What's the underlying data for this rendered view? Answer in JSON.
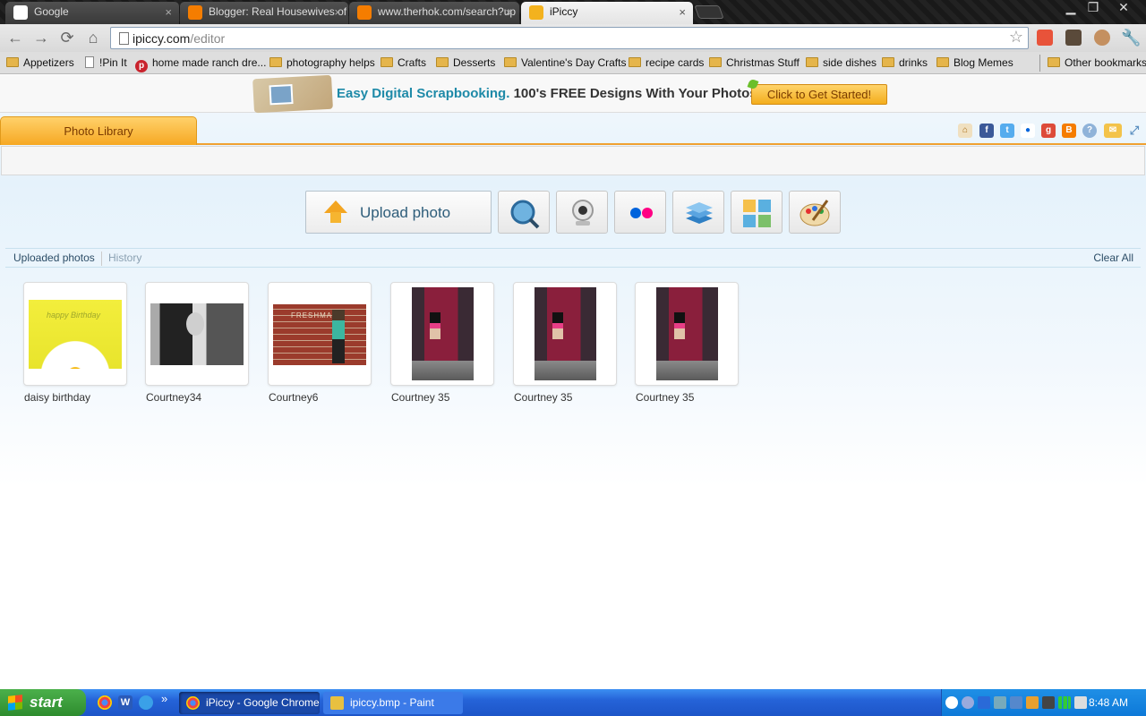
{
  "browser": {
    "tabs": [
      {
        "title": "Google",
        "active": false
      },
      {
        "title": "Blogger: Real Housewives of",
        "active": false
      },
      {
        "title": "www.therhok.com/search?up",
        "active": false
      },
      {
        "title": "iPiccy",
        "active": true
      }
    ],
    "address_bar": {
      "host": "ipiccy.com",
      "path": "/editor"
    },
    "window_controls": {
      "minimize": "▁",
      "maximize": "❐",
      "close": "✕"
    },
    "bookmarks": [
      {
        "label": "Appetizers",
        "icon": "folder-icon"
      },
      {
        "label": "!Pin It",
        "icon": "page-icon"
      },
      {
        "label": "home made ranch dre...",
        "icon": "pinterest-icon"
      },
      {
        "label": "photography helps",
        "icon": "folder-icon"
      },
      {
        "label": "Crafts",
        "icon": "folder-icon"
      },
      {
        "label": "Desserts",
        "icon": "folder-icon"
      },
      {
        "label": "Valentine's Day Crafts",
        "icon": "folder-icon"
      },
      {
        "label": "recipe cards",
        "icon": "folder-icon"
      },
      {
        "label": "Christmas Stuff",
        "icon": "folder-icon"
      },
      {
        "label": "side dishes",
        "icon": "folder-icon"
      },
      {
        "label": "drinks",
        "icon": "folder-icon"
      },
      {
        "label": "Blog Memes",
        "icon": "folder-icon"
      }
    ],
    "other_bookmarks": "Other bookmarks"
  },
  "banner": {
    "highlight": "Easy Digital Scrapbooking.",
    "text": "100's FREE Designs With Your Photos!",
    "cta": "Click to Get Started!"
  },
  "editor": {
    "library_tab": "Photo Library",
    "upload_label": "Upload photo",
    "source_tools": [
      "search-web-icon",
      "webcam-icon",
      "flickr-icon",
      "layers-icon",
      "collage-icon",
      "paint-palette-icon"
    ],
    "share_icons": [
      "home-icon",
      "facebook-icon",
      "twitter-icon",
      "flickr-icon",
      "google-plus-icon",
      "blogger-icon",
      "help-icon",
      "mail-icon",
      "fullscreen-icon"
    ],
    "photo_tabs": {
      "uploaded": "Uploaded photos",
      "history": "History",
      "clear_all": "Clear All"
    },
    "photos": [
      {
        "caption": "daisy birthday",
        "kind": "daisy",
        "overlay_text": "happy Birthday"
      },
      {
        "caption": "Courtney34",
        "kind": "bw",
        "overlay_text": ""
      },
      {
        "caption": "Courtney6",
        "kind": "brick",
        "overlay_text": "FRESHMAN"
      },
      {
        "caption": "Courtney 35",
        "kind": "train",
        "overlay_text": ""
      },
      {
        "caption": "Courtney 35",
        "kind": "train",
        "overlay_text": ""
      },
      {
        "caption": "Courtney 35",
        "kind": "train",
        "overlay_text": ""
      }
    ]
  },
  "taskbar": {
    "start_label": "start",
    "tasks": [
      {
        "label": "iPiccy - Google Chrome",
        "active": true
      },
      {
        "label": "ipiccy.bmp - Paint",
        "active": false
      }
    ],
    "quicklaunch_more": "»",
    "clock": "8:48 AM"
  },
  "colors": {
    "accent_orange": "#f6a823",
    "link_blue": "#2b4c66",
    "banner_teal": "#1e8aa8",
    "taskbar_blue": "#2563d8"
  }
}
